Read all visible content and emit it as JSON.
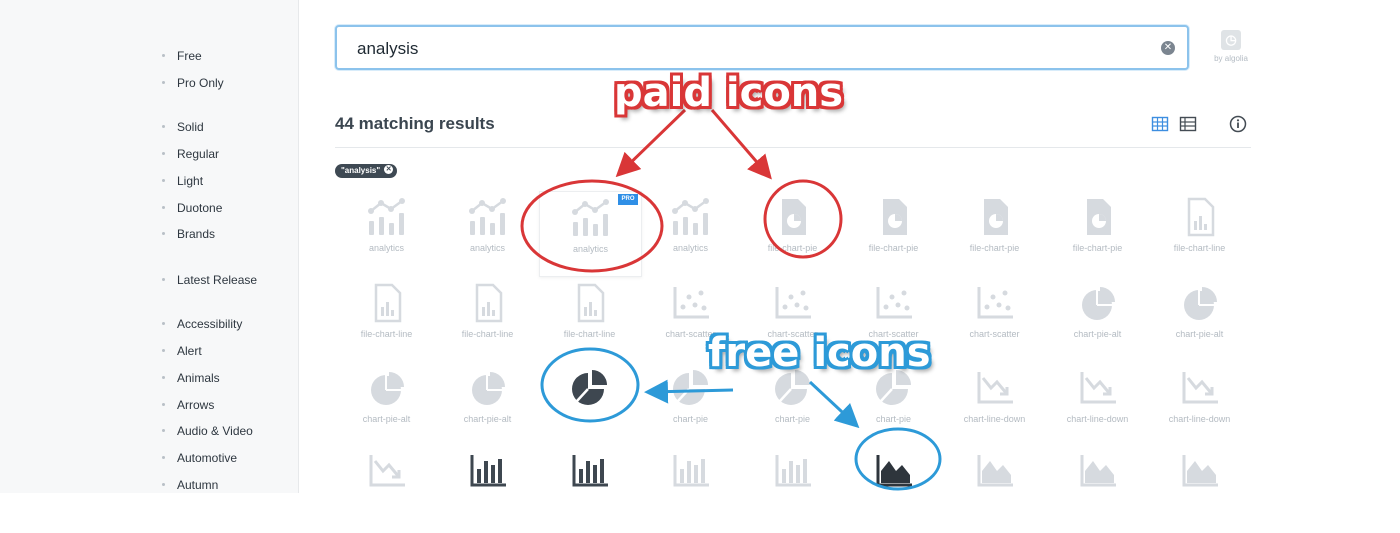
{
  "sidebar": {
    "items": [
      {
        "label": "Free"
      },
      {
        "label": "Pro Only"
      },
      {
        "label": "Solid"
      },
      {
        "label": "Regular"
      },
      {
        "label": "Light"
      },
      {
        "label": "Duotone"
      },
      {
        "label": "Brands"
      },
      {
        "label": "Latest Release"
      },
      {
        "label": "Accessibility"
      },
      {
        "label": "Alert"
      },
      {
        "label": "Animals"
      },
      {
        "label": "Arrows"
      },
      {
        "label": "Audio & Video"
      },
      {
        "label": "Automotive"
      },
      {
        "label": "Autumn"
      }
    ]
  },
  "search": {
    "value": "analysis",
    "clear_icon": "close-icon"
  },
  "algolia": {
    "by_label": "by algolia"
  },
  "results": {
    "count_text": "44 matching results"
  },
  "filter_chip": {
    "label": "\"analysis\""
  },
  "annotations": {
    "paid": "paid icons",
    "free": "free icons"
  },
  "colors": {
    "annotation_red": "#d93637",
    "annotation_blue": "#2d9ad8",
    "accent": "#2f8fe6"
  },
  "grid": {
    "row1": [
      {
        "label": "analytics",
        "icon": "analytics-icon"
      },
      {
        "label": "analytics",
        "icon": "analytics-icon"
      },
      {
        "label": "analytics",
        "icon": "analytics-icon",
        "badge": "PRO"
      },
      {
        "label": "analytics",
        "icon": "analytics-icon"
      },
      {
        "label": "file-chart-pie",
        "icon": "file-chart-pie-icon"
      },
      {
        "label": "file-chart-pie",
        "icon": "file-chart-pie-icon"
      },
      {
        "label": "file-chart-pie",
        "icon": "file-chart-pie-icon"
      },
      {
        "label": "file-chart-pie",
        "icon": "file-chart-pie-icon"
      },
      {
        "label": "file-chart-line",
        "icon": "file-chart-line-icon"
      }
    ],
    "row2": [
      {
        "label": "file-chart-line",
        "icon": "file-chart-line-icon"
      },
      {
        "label": "file-chart-line",
        "icon": "file-chart-line-icon"
      },
      {
        "label": "file-chart-line",
        "icon": "file-chart-line-icon"
      },
      {
        "label": "chart-scatter",
        "icon": "chart-scatter-icon"
      },
      {
        "label": "chart-scatter",
        "icon": "chart-scatter-icon"
      },
      {
        "label": "chart-scatter",
        "icon": "chart-scatter-icon"
      },
      {
        "label": "chart-scatter",
        "icon": "chart-scatter-icon"
      },
      {
        "label": "chart-pie-alt",
        "icon": "chart-pie-alt-icon"
      },
      {
        "label": "chart-pie-alt",
        "icon": "chart-pie-alt-icon"
      }
    ],
    "row3": [
      {
        "label": "chart-pie-alt",
        "icon": "chart-pie-alt-icon"
      },
      {
        "label": "chart-pie-alt",
        "icon": "chart-pie-alt-icon"
      },
      {
        "label": "",
        "icon": "chart-pie-icon"
      },
      {
        "label": "chart-pie",
        "icon": "chart-pie-icon"
      },
      {
        "label": "chart-pie",
        "icon": "chart-pie-icon"
      },
      {
        "label": "chart-pie",
        "icon": "chart-pie-icon"
      },
      {
        "label": "chart-line-down",
        "icon": "chart-line-down-icon"
      },
      {
        "label": "chart-line-down",
        "icon": "chart-line-down-icon"
      },
      {
        "label": "chart-line-down",
        "icon": "chart-line-down-icon"
      }
    ],
    "row4": [
      {
        "label": "",
        "icon": "chart-line-down-icon"
      },
      {
        "label": "",
        "icon": "chart-bar-icon"
      },
      {
        "label": "",
        "icon": "chart-bar-icon"
      },
      {
        "label": "",
        "icon": "chart-bar-icon"
      },
      {
        "label": "",
        "icon": "chart-bar-icon"
      },
      {
        "label": "",
        "icon": "chart-area-icon"
      },
      {
        "label": "",
        "icon": "chart-area-icon"
      },
      {
        "label": "",
        "icon": "chart-area-icon"
      },
      {
        "label": "",
        "icon": "chart-area-icon"
      }
    ]
  }
}
